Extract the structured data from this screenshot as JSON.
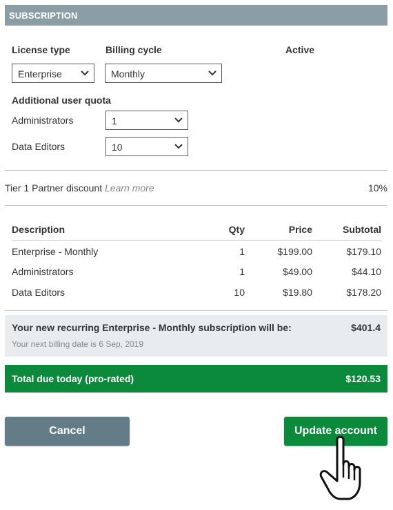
{
  "section": {
    "title": "SUBSCRIPTION"
  },
  "fields": {
    "license_type_label": "License type",
    "license_type_value": "Enterprise",
    "billing_cycle_label": "Billing cycle",
    "billing_cycle_value": "Monthly",
    "status_label": "Active",
    "quota_heading": "Additional user quota",
    "administrators_label": "Administrators",
    "administrators_value": "1",
    "data_editors_label": "Data Editors",
    "data_editors_value": "10"
  },
  "discount": {
    "label": "Tier 1 Partner discount",
    "link": "Learn more",
    "value": "10%"
  },
  "table": {
    "headers": [
      "Description",
      "Qty",
      "Price",
      "Subtotal"
    ],
    "rows": [
      [
        "Enterprise - Monthly",
        "1",
        "$199.00",
        "$179.10"
      ],
      [
        "Administrators",
        "1",
        "$49.00",
        "$44.10"
      ],
      [
        "Data Editors",
        "10",
        "$19.80",
        "$178.20"
      ]
    ]
  },
  "recurring": {
    "message": "Your new recurring Enterprise - Monthly subscription will be:",
    "amount": "$401.4",
    "next_billing": "Your next billing date is 6 Sep, 2019"
  },
  "total": {
    "label": "Total due today (pro-rated)",
    "amount": "$120.53"
  },
  "buttons": {
    "cancel": "Cancel",
    "update": "Update account"
  },
  "colors": {
    "header": "#8b9ea6",
    "primary_green": "#0b8a3c",
    "cancel_gray": "#647c88",
    "summary_bg": "#e9ecef"
  },
  "icons": [
    "chevron-down-icon",
    "hand-pointer-cursor-icon"
  ]
}
